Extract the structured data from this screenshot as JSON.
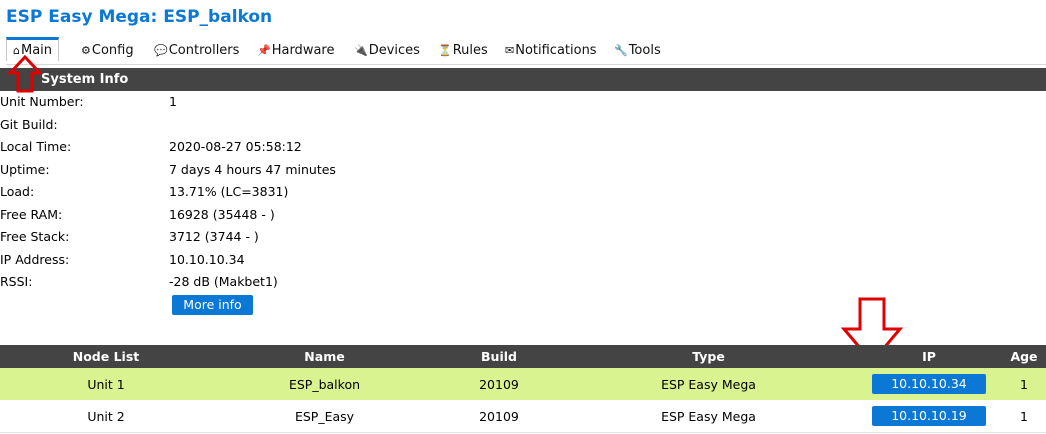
{
  "app": {
    "title": "ESP Easy Mega: ESP_balkon"
  },
  "tabs": [
    {
      "icon": "⌂",
      "label": "Main"
    },
    {
      "icon": "⚙",
      "label": "Config"
    },
    {
      "icon": "💬",
      "label": "Controllers"
    },
    {
      "icon": "📌",
      "label": "Hardware"
    },
    {
      "icon": "🔌",
      "label": "Devices"
    },
    {
      "icon": "⏳",
      "label": "Rules"
    },
    {
      "icon": "✉",
      "label": "Notifications"
    },
    {
      "icon": "🔧",
      "label": "Tools"
    }
  ],
  "system_info": {
    "header": "System Info",
    "rows": [
      {
        "label": "Unit Number:",
        "value": "1"
      },
      {
        "label": "Git Build:",
        "value": ""
      },
      {
        "label": "Local Time:",
        "value": "2020-08-27 05:58:12"
      },
      {
        "label": "Uptime:",
        "value": "7 days 4 hours 47 minutes"
      },
      {
        "label": "Load:",
        "value": "13.71% (LC=3831)"
      },
      {
        "label": "Free RAM:",
        "value": "16928 (35448 - )"
      },
      {
        "label": "Free Stack:",
        "value": "3712 (3744 - )"
      },
      {
        "label": "IP Address:",
        "value": "10.10.10.34"
      },
      {
        "label": "RSSI:",
        "value": "-28 dB (Makbet1)"
      }
    ],
    "more_info_label": "More info"
  },
  "node_list": {
    "headers": [
      "Node List",
      "Name",
      "Build",
      "Type",
      "IP",
      "Age"
    ],
    "rows": [
      {
        "unit": "Unit 1",
        "name": "ESP_balkon",
        "build": "20109",
        "type": "ESP Easy Mega",
        "ip": "10.10.10.34",
        "age": "1"
      },
      {
        "unit": "Unit 2",
        "name": "ESP_Easy",
        "build": "20109",
        "type": "ESP Easy Mega",
        "ip": "10.10.10.19",
        "age": "1"
      }
    ]
  },
  "colors": {
    "accent": "#0b78d6",
    "header_bg": "#444444",
    "highlight_row": "#d8f38f",
    "annotation_arrow": "#e00000"
  }
}
